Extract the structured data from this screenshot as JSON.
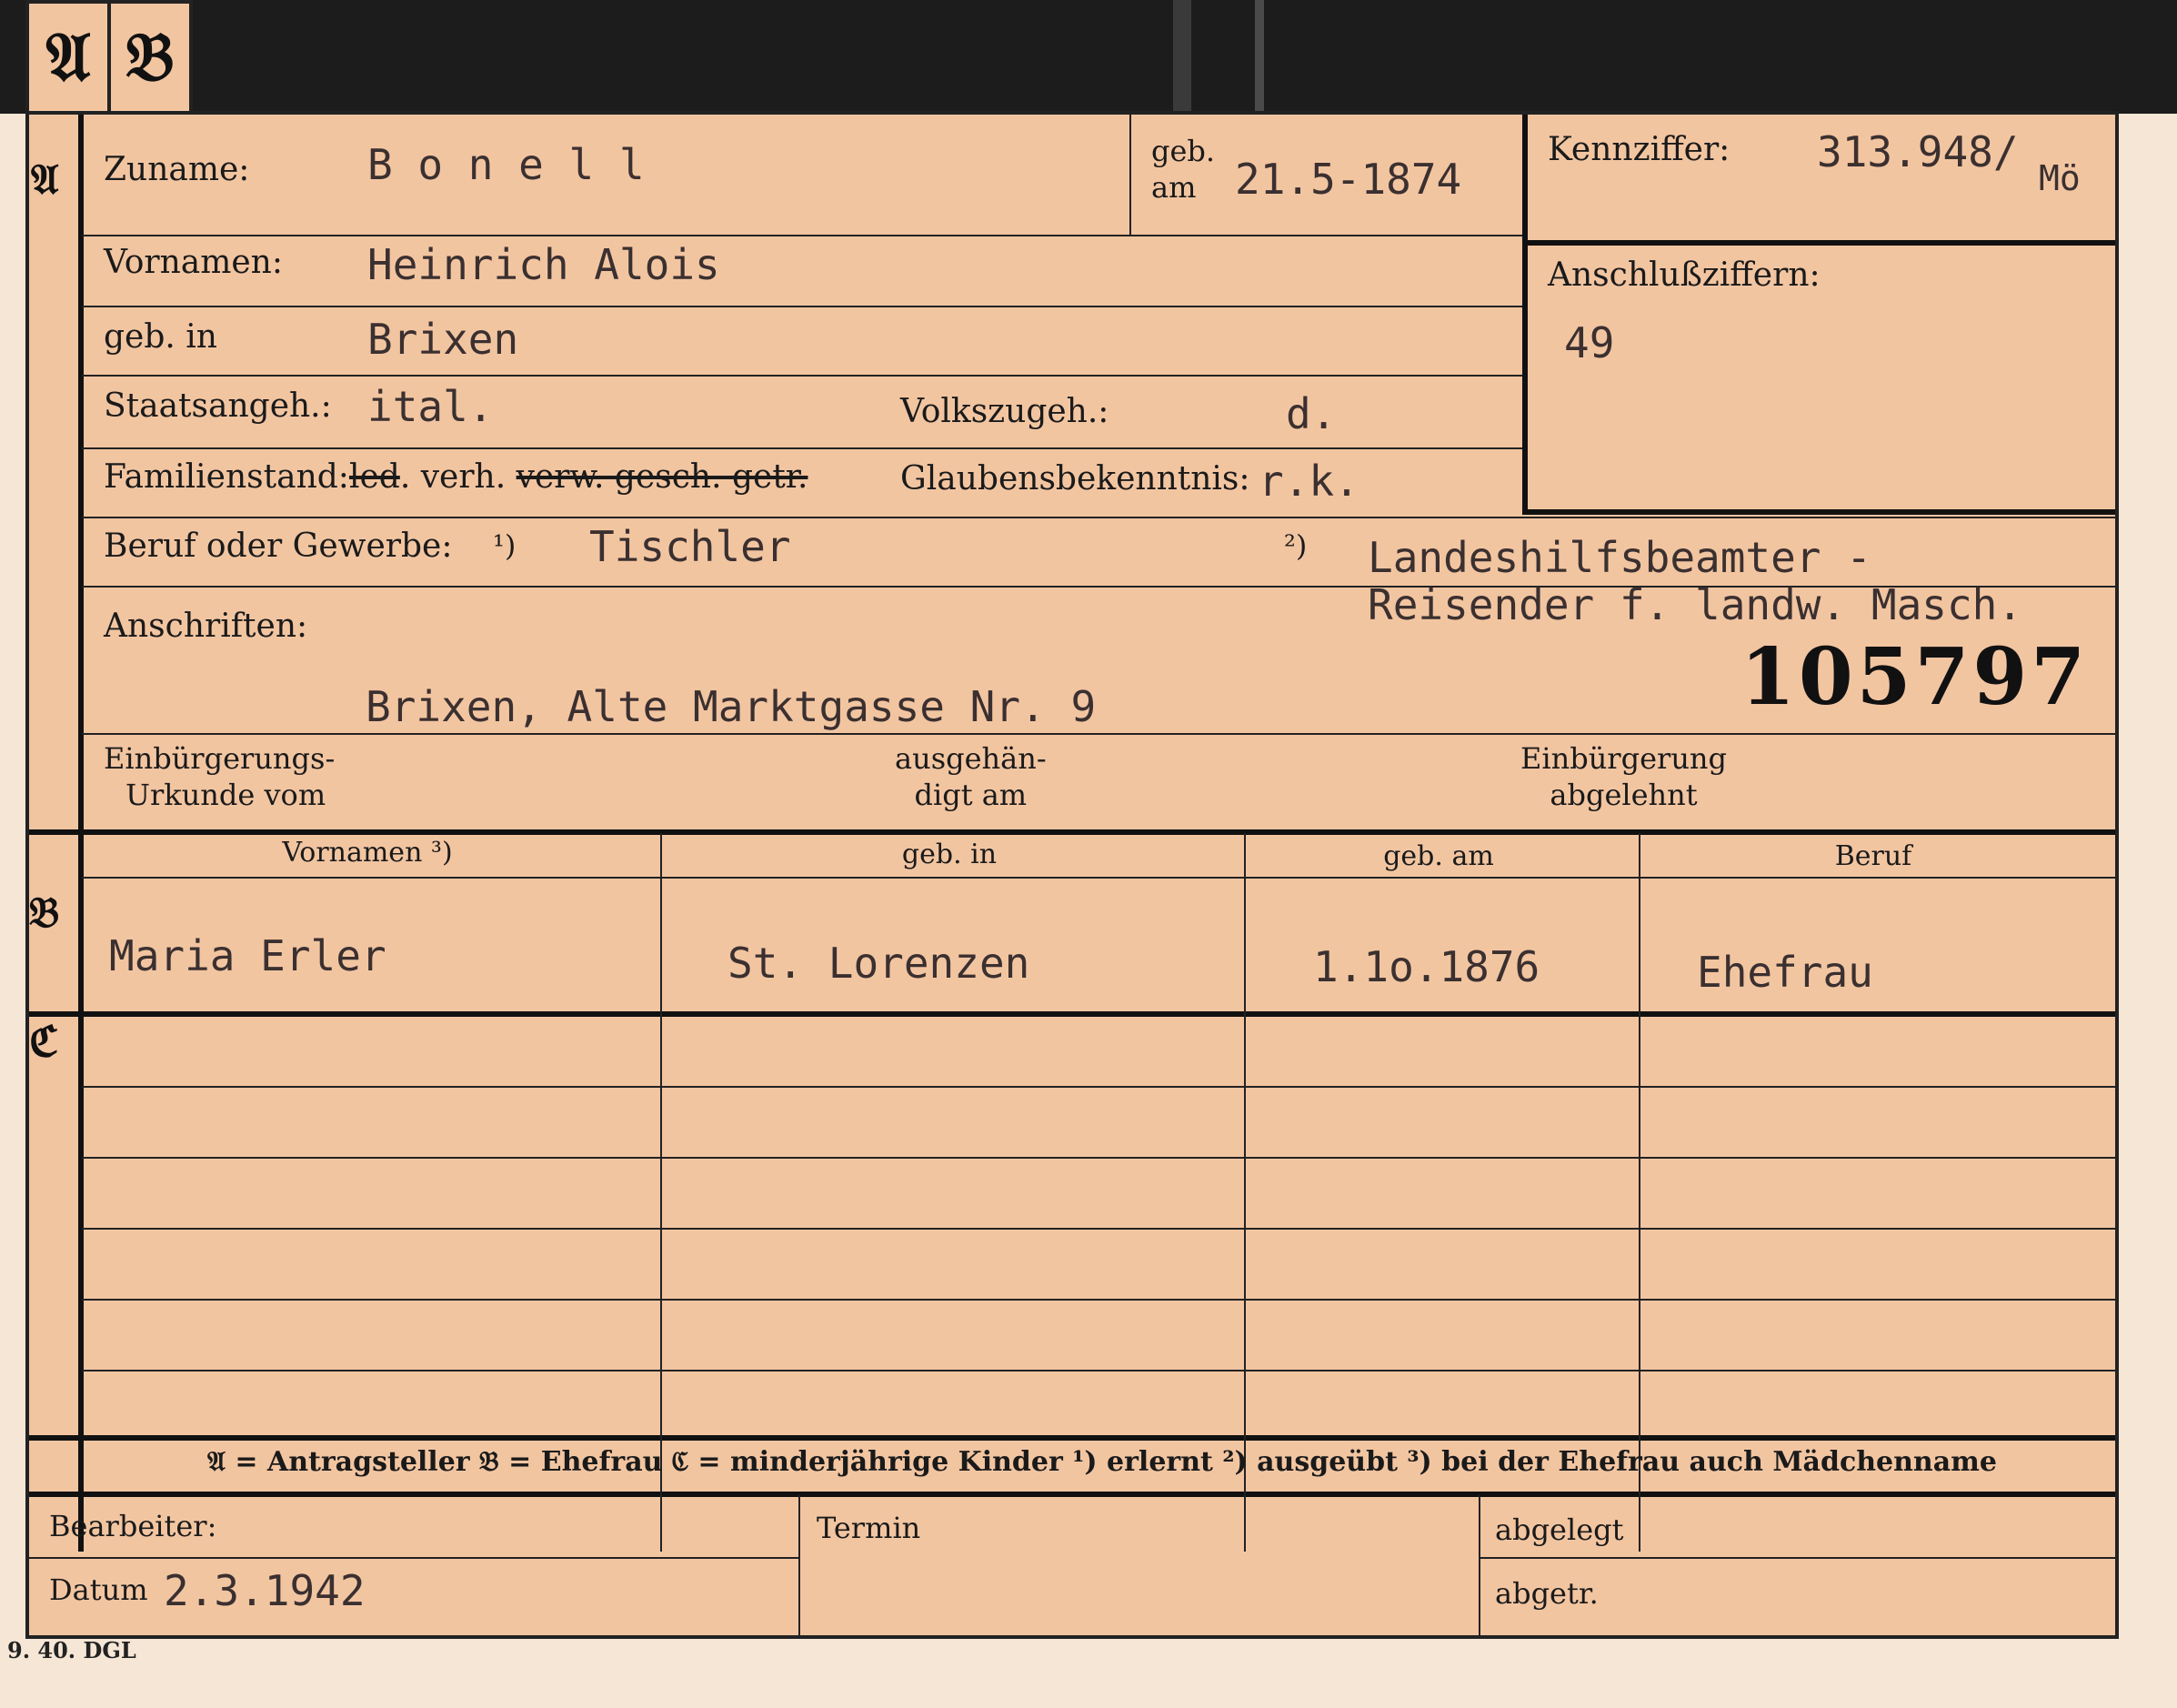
{
  "tabs": [
    "𝔄",
    "𝔅"
  ],
  "section_letters": {
    "a": "𝔄",
    "b": "𝔅",
    "c": "ℭ"
  },
  "labels": {
    "zuname": "Zuname:",
    "geb_am_1": "geb.",
    "geb_am_2": "am",
    "kennziffer": "Kennziffer:",
    "vornamen": "Vornamen:",
    "anschlussziffern": "Anschlußziffern:",
    "geb_in": "geb. in",
    "staatsangeh": "Staatsangeh.:",
    "volkszugeh": "Volkszugeh.:",
    "familienstand_prefix": "Familienstand:",
    "familienstand_struck1": "led",
    "familienstand_kept": ". verh. ",
    "familienstand_struck2": "verw. gesch. getr.",
    "glaubensbekenntnis": "Glaubensbekenntnis:",
    "beruf": "Beruf oder Gewerbe:",
    "beruf_note1": "¹)",
    "beruf_note2": "²)",
    "anschriften": "Anschriften:",
    "einb_urkunde_1": "Einbürgerungs-",
    "einb_urkunde_2": "Urkunde vom",
    "ausgehaendigt_1": "ausgehän-",
    "ausgehaendigt_2": "digt am",
    "einb_abgelehnt_1": "Einbürgerung",
    "einb_abgelehnt_2": "abgelehnt",
    "bearbeiter": "Bearbeiter:",
    "datum": "Datum",
    "termin": "Termin",
    "abgelegt": "abgelegt",
    "abgetr": "abgetr."
  },
  "values": {
    "zuname": "B o n e l l",
    "geb_am": "21.5-1874",
    "kennziffer": "313.948/",
    "kennziffer_suffix": "Mö",
    "vornamen": "Heinrich Alois",
    "anschlussziffern": "49",
    "geb_in": "Brixen",
    "staatsangeh": "ital.",
    "volkszugeh": "d.",
    "glaubensbekenntnis": "r.k.",
    "beruf1": "Tischler",
    "beruf2_line1": "Landeshilfsbeamter -",
    "beruf2_line2": "Reisender f. landw. Masch.",
    "stamp_number": "105797",
    "anschrift": "Brixen, Alte Marktgasse Nr. 9",
    "datum": "2.3.1942"
  },
  "section_b": {
    "headers": [
      "Vornamen ³)",
      "geb. in",
      "geb. am",
      "Beruf"
    ],
    "row": [
      "Maria Erler",
      "St. Lorenzen",
      "1.1o.1876",
      "Ehefrau"
    ]
  },
  "legend": "𝔄 = Antragsteller   𝔅 = Ehefrau   ℭ = minderjährige Kinder   ¹) erlernt   ²) ausgeübt   ³) bei der Ehefrau auch Mädchenname",
  "footer_code": "9. 40. DGL"
}
